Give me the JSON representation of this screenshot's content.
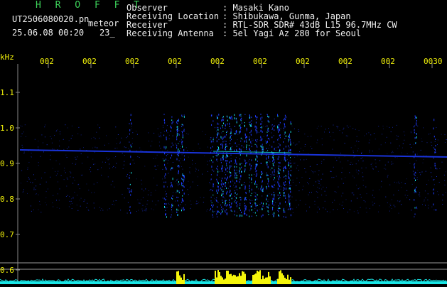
{
  "header": {
    "brand": "H R O F F T",
    "filename": "UT2506080020.pn",
    "meteor_label": "meteor",
    "datetime": "25.06.08 00:20",
    "count": "23_",
    "info": [
      {
        "key": "Observer",
        "value": ": Masaki Kano"
      },
      {
        "key": "Receiving Location",
        "value": ": Shibukawa, Gunma, Japan"
      },
      {
        "key": "Receiver",
        "value": ": RTL-SDR SDR# 43dB L15 96.7MHz CW"
      },
      {
        "key": "Receiving Antenna",
        "value": ": 5el Yagi Az 280 for Seoul"
      }
    ]
  },
  "axis": {
    "unit": "kHz",
    "y_ticks": [
      "1.1",
      "1.0",
      "0.9",
      "0.8",
      "0.7",
      "0.6"
    ],
    "x_ticks": [
      "002",
      "002",
      "002",
      "002",
      "002",
      "002",
      "002",
      "002",
      "002",
      "0030"
    ]
  },
  "colors": {
    "text_yellow": "#f2f20a",
    "text_white": "#f0f0f0",
    "brand_green": "#3cd25a",
    "signal_blue": "#1e3cff",
    "signal_cyan": "#19e6e6",
    "burst_yellow": "#f5f50a"
  }
}
